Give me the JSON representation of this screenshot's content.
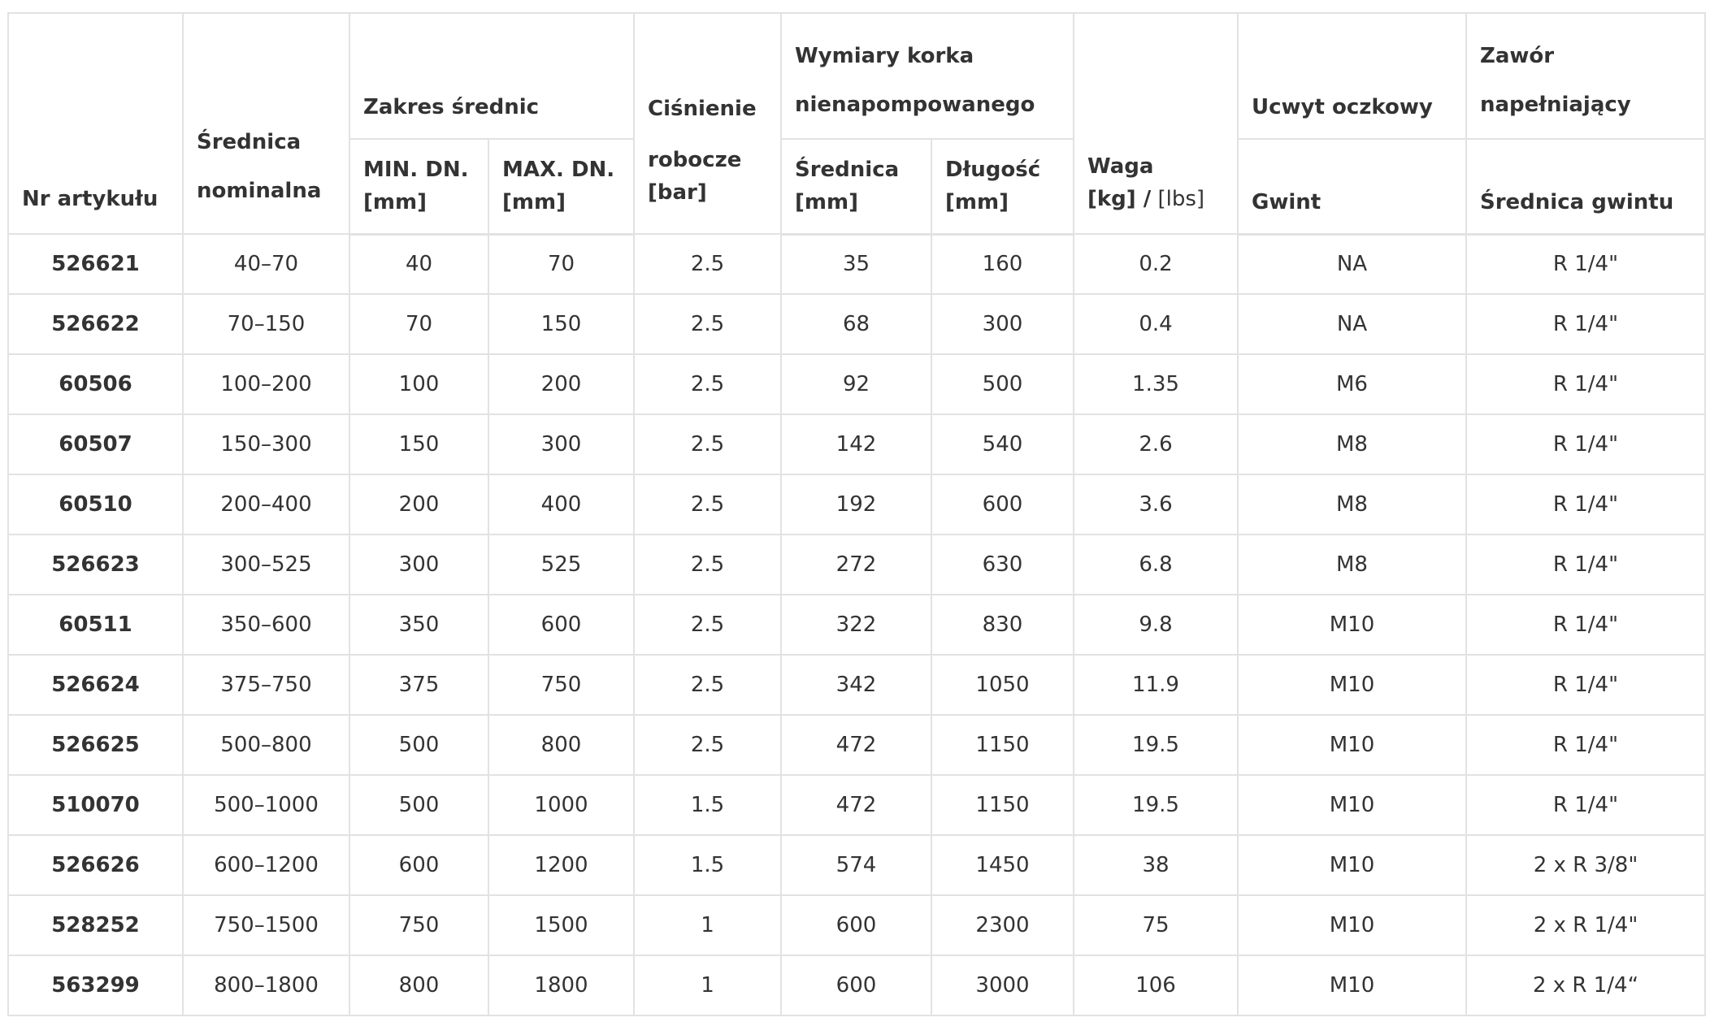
{
  "headers": {
    "nr_artykulu": "Nr artykułu",
    "srednica_nominalna_1": "Średnica",
    "srednica_nominalna_2": "nominalna",
    "zakres_srednic": "Zakres średnic",
    "min_dn_1": "MIN. DN.",
    "min_dn_2": "[mm]",
    "max_dn_1": "MAX. DN.",
    "max_dn_2": "[mm]",
    "cisnienie_1": "Ciśnienie",
    "cisnienie_2": "robocze",
    "cisnienie_3": "[bar]",
    "wymiary_1": "Wymiary korka",
    "wymiary_2": "nienapompowanego",
    "srednica_mm_1": "Średnica",
    "srednica_mm_2": "[mm]",
    "dlugosc_1": "Długość",
    "dlugosc_2": "[mm]",
    "waga_1": "Waga",
    "waga_2a": "[kg] /",
    "waga_2b": " [lbs]",
    "uchwyt": "Ucwyt oczkowy",
    "gwint": "Gwint",
    "zawor_1": "Zawór",
    "zawor_2": "napełniający",
    "srednica_gwintu": "Średnica gwintu"
  },
  "rows": [
    {
      "art": "526621",
      "nom": "40–70",
      "min": "40",
      "max": "70",
      "pres": "2.5",
      "sd": "35",
      "len": "160",
      "w": "0.2",
      "gw": "NA",
      "sg": "R 1/4\""
    },
    {
      "art": "526622",
      "nom": "70–150",
      "min": "70",
      "max": "150",
      "pres": "2.5",
      "sd": "68",
      "len": "300",
      "w": "0.4",
      "gw": "NA",
      "sg": "R 1/4\""
    },
    {
      "art": "60506",
      "nom": "100–200",
      "min": "100",
      "max": "200",
      "pres": "2.5",
      "sd": "92",
      "len": "500",
      "w": "1.35",
      "gw": "M6",
      "sg": "R 1/4\""
    },
    {
      "art": "60507",
      "nom": "150–300",
      "min": "150",
      "max": "300",
      "pres": "2.5",
      "sd": "142",
      "len": "540",
      "w": "2.6",
      "gw": "M8",
      "sg": "R 1/4\""
    },
    {
      "art": "60510",
      "nom": "200–400",
      "min": "200",
      "max": "400",
      "pres": "2.5",
      "sd": "192",
      "len": "600",
      "w": "3.6",
      "gw": "M8",
      "sg": "R 1/4\""
    },
    {
      "art": "526623",
      "nom": "300–525",
      "min": "300",
      "max": "525",
      "pres": "2.5",
      "sd": "272",
      "len": "630",
      "w": "6.8",
      "gw": "M8",
      "sg": "R 1/4\""
    },
    {
      "art": "60511",
      "nom": "350–600",
      "min": "350",
      "max": "600",
      "pres": "2.5",
      "sd": "322",
      "len": "830",
      "w": "9.8",
      "gw": "M10",
      "sg": "R 1/4\""
    },
    {
      "art": "526624",
      "nom": "375–750",
      "min": "375",
      "max": "750",
      "pres": "2.5",
      "sd": "342",
      "len": "1050",
      "w": "11.9",
      "gw": "M10",
      "sg": "R 1/4\""
    },
    {
      "art": "526625",
      "nom": "500–800",
      "min": "500",
      "max": "800",
      "pres": "2.5",
      "sd": "472",
      "len": "1150",
      "w": "19.5",
      "gw": "M10",
      "sg": "R 1/4\""
    },
    {
      "art": "510070",
      "nom": "500–1000",
      "min": "500",
      "max": "1000",
      "pres": "1.5",
      "sd": "472",
      "len": "1150",
      "w": "19.5",
      "gw": "M10",
      "sg": "R 1/4\""
    },
    {
      "art": "526626",
      "nom": "600–1200",
      "min": "600",
      "max": "1200",
      "pres": "1.5",
      "sd": "574",
      "len": "1450",
      "w": "38",
      "gw": "M10",
      "sg": "2 x R 3/8\""
    },
    {
      "art": "528252",
      "nom": "750–1500",
      "min": "750",
      "max": "1500",
      "pres": "1",
      "sd": "600",
      "len": "2300",
      "w": "75",
      "gw": "M10",
      "sg": "2 x R 1/4\""
    },
    {
      "art": "563299",
      "nom": "800–1800",
      "min": "800",
      "max": "1800",
      "pres": "1",
      "sd": "600",
      "len": "3000",
      "w": "106",
      "gw": "M10",
      "sg": "2 x R 1/4“"
    }
  ]
}
